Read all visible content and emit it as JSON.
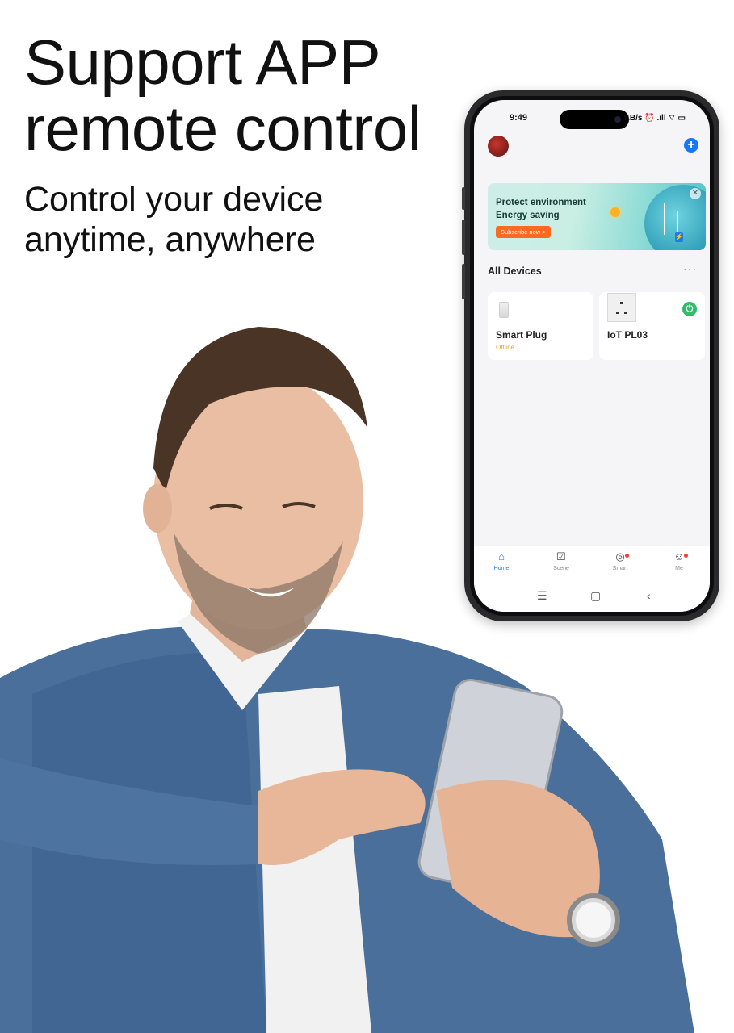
{
  "headline": {
    "line1": "Support APP",
    "line2": "remote control",
    "sub1": "Control your device",
    "sub2": "anytime, anywhere"
  },
  "phone": {
    "status": {
      "time": "9:49",
      "right": "KB/s ⏰ .ıll ⌔ ▭"
    },
    "banner": {
      "line1": "Protect environment",
      "line2": "Energy saving",
      "button": "Subscribe now >"
    },
    "section_title": "All Devices",
    "devices": [
      {
        "name": "Smart Plug",
        "status": "Offline"
      },
      {
        "name": "IoT PL03",
        "status": ""
      }
    ],
    "tabs": [
      {
        "label": "Home",
        "icon": "home-icon"
      },
      {
        "label": "Scene",
        "icon": "scene-icon"
      },
      {
        "label": "Smart",
        "icon": "smart-icon"
      },
      {
        "label": "Me",
        "icon": "me-icon"
      }
    ],
    "colors": {
      "accent": "#1677ff",
      "subscribe": "#ff6a21",
      "online": "#2ebd6b",
      "offline": "#f0a020"
    }
  }
}
